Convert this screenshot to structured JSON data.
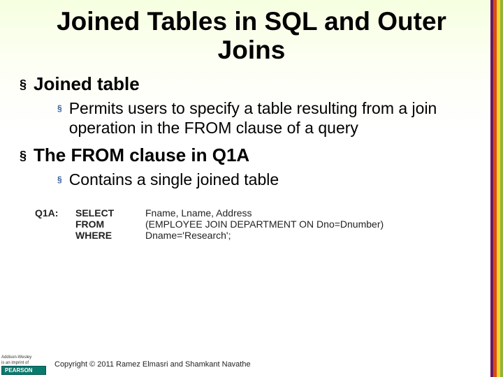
{
  "title": "Joined Tables in SQL and Outer Joins",
  "bullets": {
    "b1a": "Joined table",
    "b2a": "Permits users to specify a table resulting from a join operation in the FROM clause of a query",
    "b1b": "The FROM clause in Q1A",
    "b2b": "Contains a single joined table"
  },
  "query": {
    "label": "Q1A:",
    "rows": [
      {
        "kw": "SELECT",
        "val": "Fname, Lname, Address"
      },
      {
        "kw": "FROM",
        "val": "(EMPLOYEE JOIN DEPARTMENT ON Dno=Dnumber)"
      },
      {
        "kw": "WHERE",
        "val": "Dname='Research';"
      }
    ]
  },
  "logo": {
    "line1": "Addison-Wesley",
    "line2": "is an imprint of",
    "brand": "PEARSON"
  },
  "copyright": "Copyright © 2011 Ramez Elmasri and Shamkant Navathe"
}
